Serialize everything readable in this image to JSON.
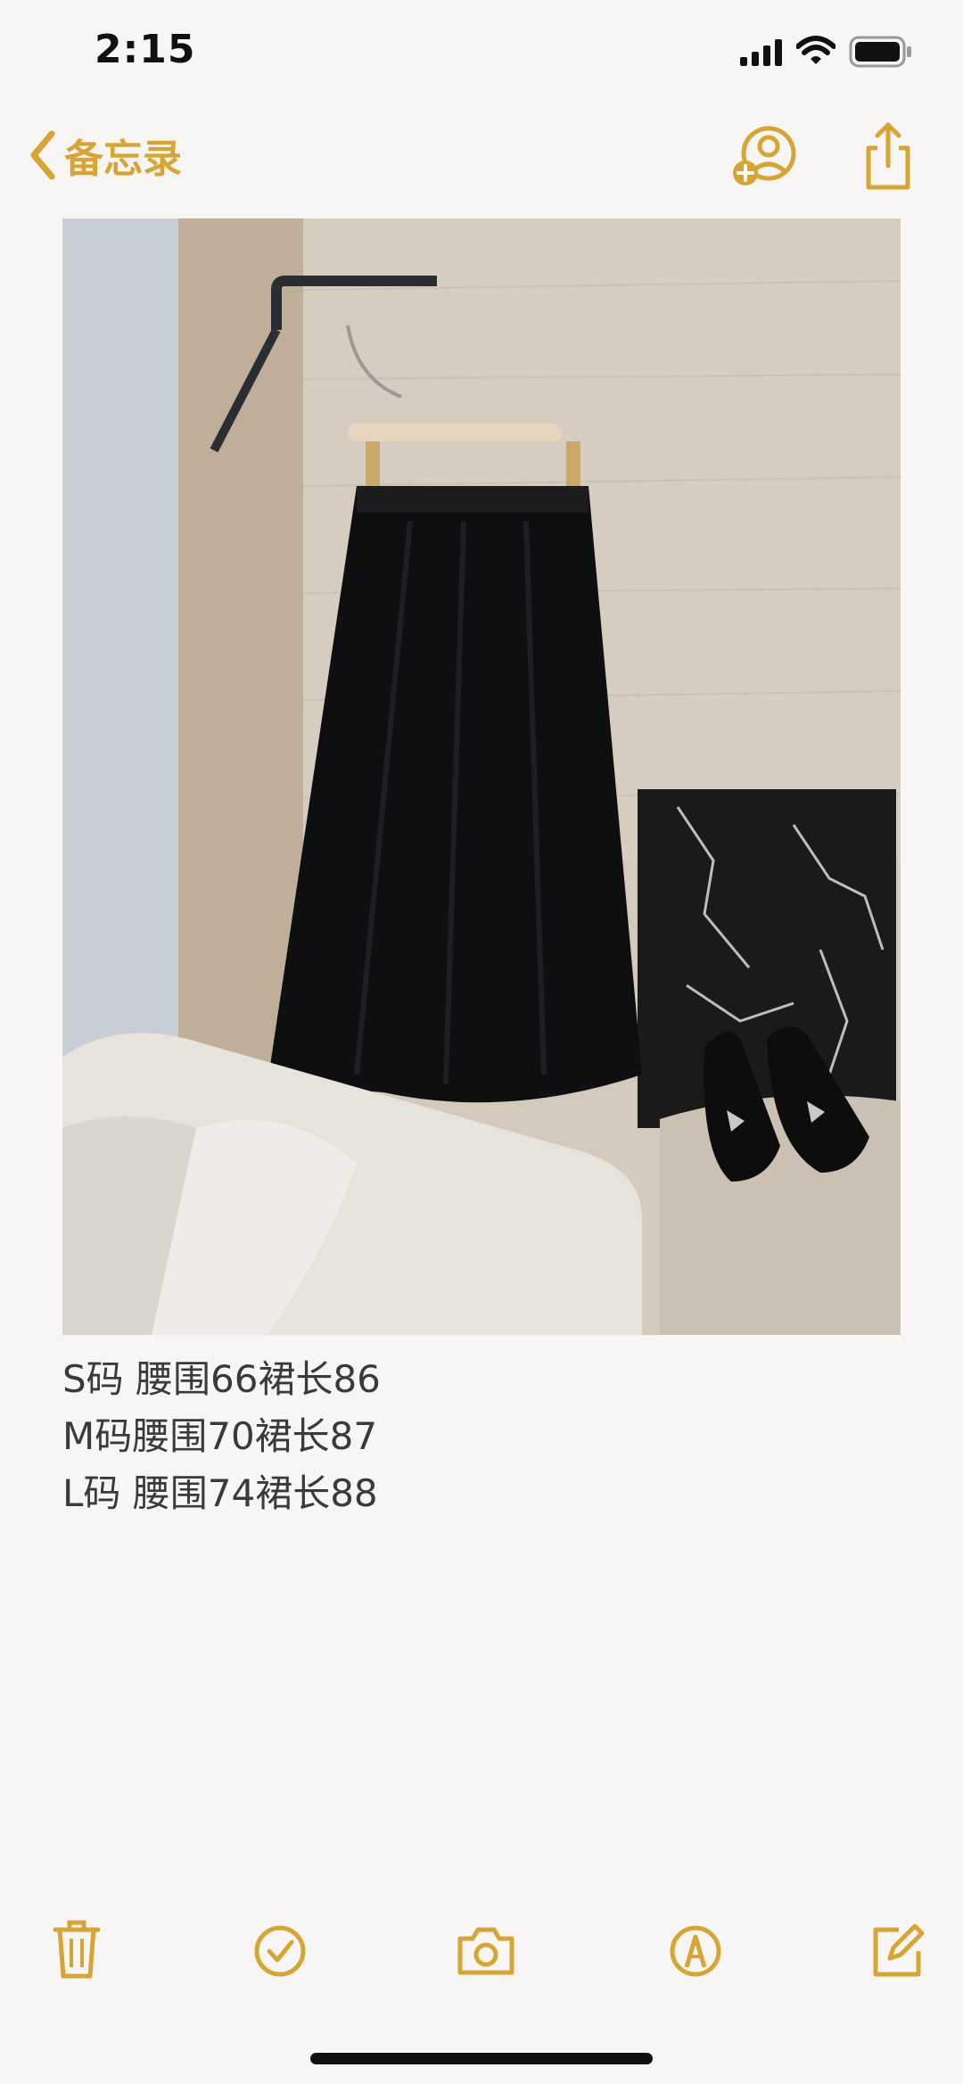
{
  "status_bar": {
    "time": "2:15",
    "signal_icon": "cellular-signal-icon",
    "wifi_icon": "wifi-icon",
    "battery_icon": "battery-icon"
  },
  "nav": {
    "back_label": "备忘录",
    "back_icon": "chevron-left-icon",
    "share_person_icon": "person-add-icon",
    "share_icon": "share-icon",
    "accent_color": "#d7a534"
  },
  "photo": {
    "description_icon": "photo-skirt-on-hanger"
  },
  "note": {
    "lines": [
      "S码 腰围66裙长86",
      "M码腰围70裙长87",
      "L码 腰围74裙长88"
    ]
  },
  "toolbar": {
    "items": [
      "trash-icon",
      "checklist-icon",
      "camera-icon",
      "markup-pen-icon",
      "compose-icon"
    ]
  }
}
